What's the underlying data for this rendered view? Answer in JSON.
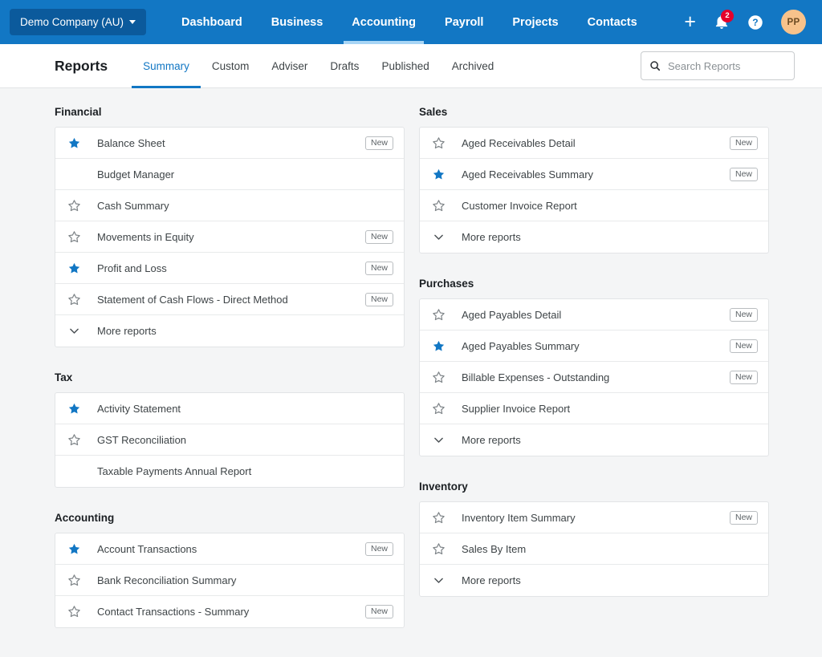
{
  "topnav": {
    "org_button": {
      "label": "Demo Company (AU)",
      "caret_icon": "caret-down-icon"
    },
    "links": [
      {
        "label": "Dashboard",
        "active": false
      },
      {
        "label": "Business",
        "active": false
      },
      {
        "label": "Accounting",
        "active": true
      },
      {
        "label": "Payroll",
        "active": false
      },
      {
        "label": "Projects",
        "active": false
      },
      {
        "label": "Contacts",
        "active": false
      }
    ],
    "add_icon": "plus-icon",
    "notifications": {
      "icon": "bell-icon",
      "count": "2"
    },
    "help_icon": "question-circle-icon",
    "avatar": {
      "initials": "PP"
    },
    "colors": {
      "bar": "#1277c4",
      "org_button": "#0b5a9c",
      "badge": "#e4002b",
      "avatar": "#f7c28b"
    }
  },
  "subheader": {
    "title": "Reports",
    "tabs": [
      {
        "label": "Summary",
        "active": true
      },
      {
        "label": "Custom",
        "active": false
      },
      {
        "label": "Adviser",
        "active": false
      },
      {
        "label": "Drafts",
        "active": false
      },
      {
        "label": "Published",
        "active": false
      },
      {
        "label": "Archived",
        "active": false
      }
    ],
    "search": {
      "placeholder": "Search Reports",
      "value": "",
      "icon": "search-icon"
    }
  },
  "labels": {
    "new_badge": "New",
    "more_reports": "More reports"
  },
  "left_column": [
    {
      "title": "Financial",
      "items": [
        {
          "label": "Balance Sheet",
          "star": "filled",
          "new": true
        },
        {
          "label": "Budget Manager",
          "star": "none",
          "new": false
        },
        {
          "label": "Cash Summary",
          "star": "outline",
          "new": false
        },
        {
          "label": "Movements in Equity",
          "star": "outline",
          "new": true
        },
        {
          "label": "Profit and Loss",
          "star": "filled",
          "new": true
        },
        {
          "label": "Statement of Cash Flows - Direct Method",
          "star": "outline",
          "new": true
        },
        {
          "label": "More reports",
          "star": "chevron",
          "new": false
        }
      ]
    },
    {
      "title": "Tax",
      "items": [
        {
          "label": "Activity Statement",
          "star": "filled",
          "new": false
        },
        {
          "label": "GST Reconciliation",
          "star": "outline",
          "new": false
        },
        {
          "label": "Taxable Payments Annual Report",
          "star": "none",
          "new": false
        }
      ]
    },
    {
      "title": "Accounting",
      "items": [
        {
          "label": "Account Transactions",
          "star": "filled",
          "new": true
        },
        {
          "label": "Bank Reconciliation Summary",
          "star": "outline",
          "new": false
        },
        {
          "label": "Contact Transactions - Summary",
          "star": "outline",
          "new": true
        }
      ]
    }
  ],
  "right_column": [
    {
      "title": "Sales",
      "items": [
        {
          "label": "Aged Receivables Detail",
          "star": "outline",
          "new": true
        },
        {
          "label": "Aged Receivables Summary",
          "star": "filled",
          "new": true
        },
        {
          "label": "Customer Invoice Report",
          "star": "outline",
          "new": false
        },
        {
          "label": "More reports",
          "star": "chevron",
          "new": false
        }
      ]
    },
    {
      "title": "Purchases",
      "items": [
        {
          "label": "Aged Payables Detail",
          "star": "outline",
          "new": true
        },
        {
          "label": "Aged Payables Summary",
          "star": "filled",
          "new": true
        },
        {
          "label": "Billable Expenses - Outstanding",
          "star": "outline",
          "new": true
        },
        {
          "label": "Supplier Invoice Report",
          "star": "outline",
          "new": false
        },
        {
          "label": "More reports",
          "star": "chevron",
          "new": false
        }
      ]
    },
    {
      "title": "Inventory",
      "items": [
        {
          "label": "Inventory Item Summary",
          "star": "outline",
          "new": true
        },
        {
          "label": "Sales By Item",
          "star": "outline",
          "new": false
        },
        {
          "label": "More reports",
          "star": "chevron",
          "new": false
        }
      ]
    }
  ]
}
